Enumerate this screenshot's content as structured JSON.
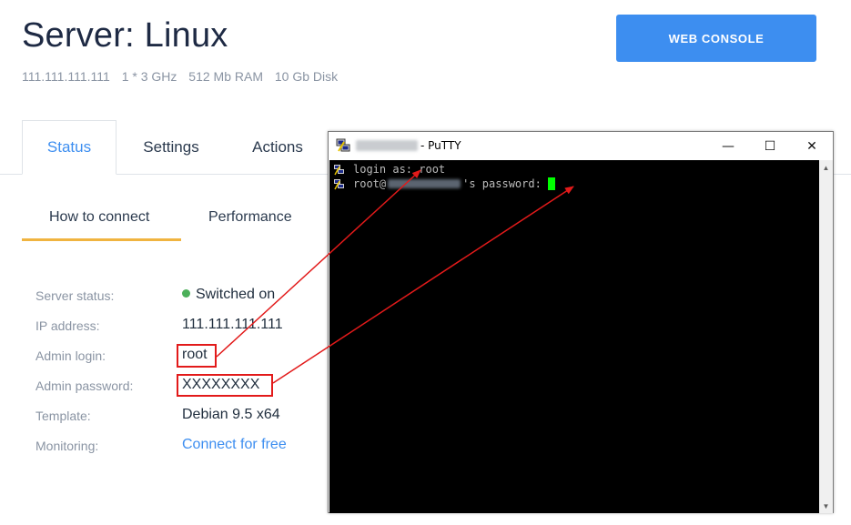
{
  "header": {
    "title": "Server: Linux",
    "specs": [
      "111.111.111.111",
      "1 * 3 GHz",
      "512 Mb RAM",
      "10 Gb Disk"
    ],
    "web_console_label": "WEB CONSOLE"
  },
  "tabs": [
    {
      "label": "Status",
      "active": true
    },
    {
      "label": "Settings",
      "active": false
    },
    {
      "label": "Actions",
      "active": false
    }
  ],
  "subtabs": [
    {
      "label": "How to connect",
      "active": true
    },
    {
      "label": "Performance",
      "active": false
    }
  ],
  "info": [
    {
      "label": "Server status:",
      "value": "Switched on"
    },
    {
      "label": "IP address:",
      "value": "111.111.111.111"
    },
    {
      "label": "Admin login:",
      "value": "root"
    },
    {
      "label": "Admin password:",
      "value": "XXXXXXXX"
    },
    {
      "label": "Template:",
      "value": "Debian 9.5 x64"
    },
    {
      "label": "Monitoring:",
      "value": "Connect for free"
    }
  ],
  "putty": {
    "title": "- PuTTY",
    "minimize": "—",
    "maximize": "☐",
    "close": "✕",
    "line1": "login as: root",
    "line2_prefix": "root@",
    "line2_suffix": "'s password: "
  },
  "colors": {
    "accent": "#3d8ef0",
    "status_on": "#4cb05a",
    "highlight": "#e21a1a",
    "tab_underline": "#f0b440",
    "cursor": "#00ff00"
  }
}
